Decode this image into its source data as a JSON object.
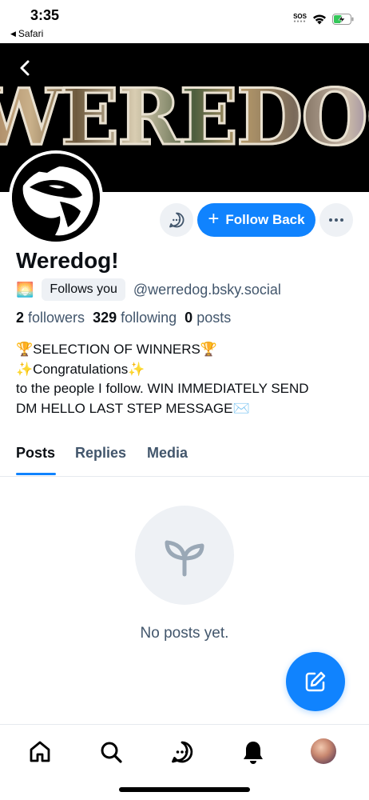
{
  "status_bar": {
    "time": "3:35",
    "back_app": "Safari",
    "sos": "SOS"
  },
  "banner": {
    "text": "WEREDOG"
  },
  "actions": {
    "follow_label": "Follow Back"
  },
  "profile": {
    "display_name": "Weredog!",
    "emoji": "🌅",
    "follows_you": "Follows you",
    "handle": "@werredog.bsky.social",
    "followers_count": "2",
    "followers_label": "followers",
    "following_count": "329",
    "following_label": "following",
    "posts_count": "0",
    "posts_label": "posts",
    "bio": [
      "🏆SELECTION OF WINNERS🏆",
      "✨Congratulations✨",
      "to the people I follow. WIN IMMEDIATELY SEND",
      "DM HELLO LAST STEP MESSAGE✉️"
    ]
  },
  "tabs": [
    {
      "label": "Posts",
      "active": true
    },
    {
      "label": "Replies",
      "active": false
    },
    {
      "label": "Media",
      "active": false
    }
  ],
  "empty_state": {
    "text": "No posts yet.",
    "icon": "sprout-icon"
  },
  "bottom_nav": [
    {
      "icon": "home-icon"
    },
    {
      "icon": "search-icon"
    },
    {
      "icon": "chat-icon"
    },
    {
      "icon": "bell-icon"
    },
    {
      "icon": "profile-avatar"
    }
  ],
  "colors": {
    "accent": "#1083fe",
    "muted_text": "#42566c",
    "chip_background": "#eef1f5"
  }
}
